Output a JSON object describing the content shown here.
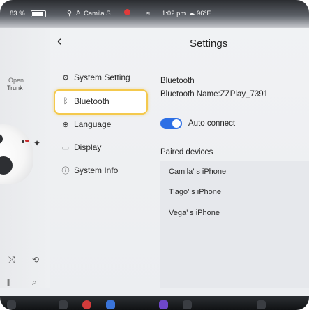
{
  "status_bar": {
    "battery": "83 %",
    "user": "Camila S",
    "time": "1:02 pm",
    "temperature": "96°F"
  },
  "left_panel": {
    "open_label": "Open",
    "trunk_label": "Trunk"
  },
  "header": {
    "back_icon": "‹",
    "title": "Settings"
  },
  "menu": {
    "items": [
      {
        "label": "System Setting",
        "icon": "gear-icon"
      },
      {
        "label": "Bluetooth",
        "icon": "bluetooth-icon",
        "selected": true
      },
      {
        "label": "Language",
        "icon": "globe-icon"
      },
      {
        "label": "Display",
        "icon": "display-icon"
      },
      {
        "label": "System Info",
        "icon": "info-icon"
      }
    ]
  },
  "bluetooth": {
    "heading": "Bluetooth",
    "name_line": "Bluetooth Name:ZZPlay_7391",
    "auto_connect_label": "Auto connect",
    "auto_connect_on": true,
    "paired_heading": "Paired devices",
    "devices": [
      "Camila’ s iPhone",
      "Tiago’ s iPhone",
      "Vega’ s iPhone"
    ]
  },
  "colors": {
    "accent": "#2d6fe5",
    "selection_border": "#f4c94d",
    "background": "#eef0f2"
  }
}
